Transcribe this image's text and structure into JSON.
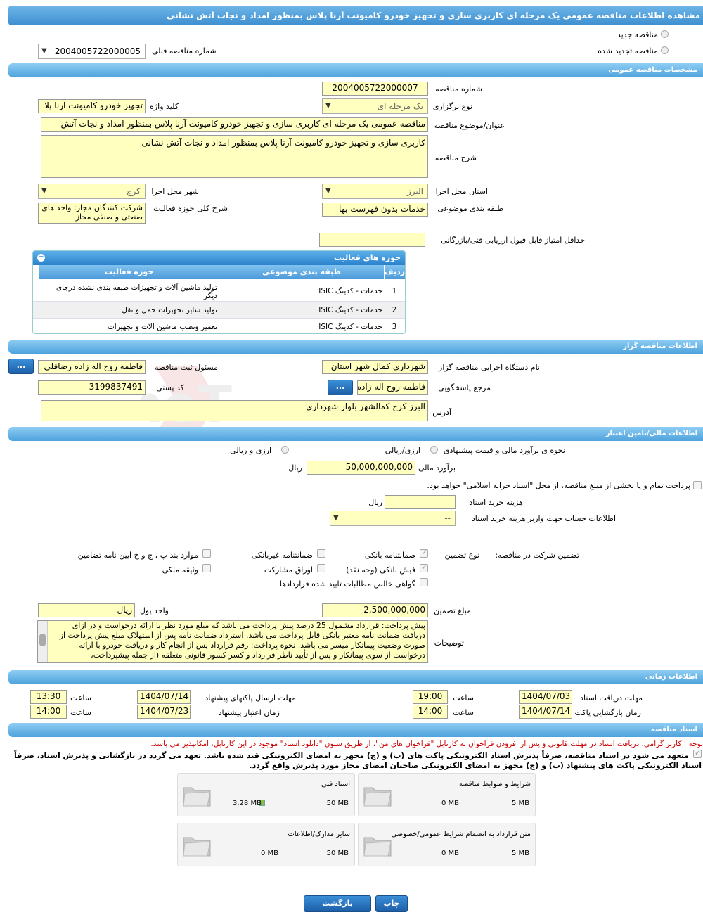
{
  "title": "مشاهده اطلاعات مناقصه عمومی یک مرحله ای کاربری سازی و تجهیز خودرو کامیونت آرنا پلاس بمنظور امداد و نجات آتش نشانی",
  "top": {
    "new_tender": "مناقصه جدید",
    "renewed_tender": "مناقصه تجدید شده",
    "prev_number_label": "شماره مناقصه قبلی",
    "prev_number": "2004005722000005"
  },
  "general": {
    "header": "مشخصات مناقصه عمومی",
    "number_label": "شماره مناقصه",
    "number": "2004005722000007",
    "type_label": "نوع برگزاری",
    "type": "یک مرحله ای",
    "keyword_label": "کلید واژه",
    "keyword": "تجهیز خودرو کامیونت آرنا پلا",
    "subject_label": "عنوان/موضوع مناقصه",
    "subject": "مناقصه عمومی یک مرحله ای کاربری سازی و تجهیز خودرو کامیونت آرنا پلاس بمنظور امداد و نجات آتش",
    "desc_label": "شرح مناقصه",
    "desc": "کاربری سازی و تجهیز خودرو کامیونت آرنا پلاس بمنظور امداد و نجات آتش نشانی",
    "province_label": "استان محل اجرا",
    "province": "البرز",
    "city_label": "شهر محل اجرا",
    "city": "کرج",
    "category_label": "طبقه بندی موضوعی",
    "category": "خدمات بدون فهرست بها",
    "activity_label": "شرح کلی حوزه فعالیت",
    "activity": "شرکت کنندگان مجاز: واحد های صنعتی و صنفی مجاز",
    "min_score_label": "حداقل امتیاز قابل قبول ارزیابی فنی/بازرگانی",
    "min_score": ""
  },
  "activities": {
    "header": "حوزه های فعالیت",
    "cols": [
      "ردیف",
      "طبقه بندی موضوعی",
      "حوزه فعالیت"
    ],
    "rows": [
      {
        "n": "1",
        "cat": "خدمات - کدینگ ISIC",
        "area": "تولید ماشین آلات و تجهیزات طبقه بندی نشده درجای دیگر"
      },
      {
        "n": "2",
        "cat": "خدمات - کدینگ ISIC",
        "area": "تولید سایر تجهیزات حمل و نقل"
      },
      {
        "n": "3",
        "cat": "خدمات - کدینگ ISIC",
        "area": "تعمیر ونصب ماشین آلات و تجهیزات"
      }
    ]
  },
  "organizer": {
    "header": "اطلاعات مناقصه گزار",
    "org_label": "نام دستگاه اجرایی مناقصه گزار",
    "org": "شهرداری کمال شهر استان",
    "registrar_label": "مسئول ثبت مناقصه",
    "registrar": "فاطمه روح اله زاده رضاقلی",
    "contact_label": "مرجع پاسخگویی",
    "contact": "فاطمه روح اله زاده",
    "postal_label": "کد پستی",
    "postal": "3199837491",
    "address_label": "آدرس",
    "address": "البرز کرج کمالشهر بلوار شهرداری",
    "more": "..."
  },
  "finance": {
    "header": "اطلاعات مالی/تامین اعتبار",
    "estimate_type_label": "نحوه ی برآورد مالی و قیمت پیشنهادی",
    "opt1": "ارزی/ریالی",
    "opt2": "ارزی و ریالی",
    "estimate_label": "برآورد مالی",
    "estimate": "50,000,000,000",
    "rial": "ریال",
    "treasury_text": "پرداخت تمام و یا بخشی از مبلغ مناقصه، از محل \"اسناد خزانه اسلامی\" خواهد بود.",
    "doc_cost_label": "هزینه خرید اسناد",
    "doc_cost": "",
    "account_label": "اطلاعات حساب جهت واریز هزینه خرید اسناد",
    "account": "--"
  },
  "guarantee": {
    "participation_label": "تضمین شرکت در مناقصه:",
    "type_label": "نوع تضمین",
    "bank_guarantee": "ضمانتنامه بانکی",
    "nonbank_guarantee": "ضمانتنامه غیربانکی",
    "articles": "موارد بند پ ، ج و خ آیین نامه تضامین",
    "bank_check": "فیش بانکی (وجه نقد)",
    "bonds": "اوراق مشارکت",
    "property": "وثیقه ملکی",
    "claims": "گواهی خالص مطالبات تایید شده قراردادها",
    "amount_label": "مبلغ تضمین",
    "amount": "2,500,000,000",
    "currency_label": "واحد پول",
    "currency": "ریال",
    "notes_label": "توضیحات",
    "notes": "پیش پرداخت: قرارداد مشمول 25 درصد پیش پرداخت می باشد که مبلغ مورد نظر با ارائه درخواست و در ازای دریافت ضمانت نامه معتبر بانکی قابل پرداخت می باشد. استرداد ضمانت نامه پس از استهلاک مبلغ پیش پرداخت از صورت وضعیت پیمانکار میسر می باشد. نحوه پرداخت: رقم قرارداد پس از انجام کار و دریافت خودرو با ارائه درخواست از سوی پیمانکار و پس از تأیید ناظر قرارداد و کسر کسور قانونی متعلقه (از جمله پیشپرداخت،"
  },
  "timing": {
    "header": "اطلاعات زمانی",
    "doc_deadline_label": "مهلت دریافت اسناد",
    "doc_deadline": "1404/07/03",
    "time_label": "ساعت",
    "doc_time": "19:00",
    "send_label": "مهلت ارسال پاکتهای پیشنهاد",
    "send_date": "1404/07/14",
    "send_time": "13:30",
    "open_label": "زمان بازگشایی پاکت ها",
    "open_date": "1404/07/14",
    "open_time": "14:00",
    "valid_label": "زمان اعتبار پیشنهاد",
    "valid_date": "1404/07/23",
    "valid_time": "14:00"
  },
  "docs": {
    "header": "اسناد مناقصه",
    "notice": "توجه : کاربر گرامی، دریافت اسناد در مهلت قانونی و پس از افزودن فراخوان به کارتابل \"فراخوان های من\"، از طریق ستون \"دانلود اسناد\" موجود در این کارتابل، امکانپذیر می باشد.",
    "commit": "متعهد می شود در اسناد مناقصه، صرفاً پذیرش اسناد الکترونیکی پاکت های (ب) و (ج) مجهز به امضای الکترونیکی قید شده باشد. تعهد می گردد در بازگشایی و پذیرش اسناد، صرفاً اسناد الکترونیکی پاکت های پیشنهاد (ب) و (ج) مجهز به امضای الکترونیکی صاحبان امضای مجاز مورد پذیرش واقع گردد.",
    "files": [
      {
        "name": "شرایط و ضوابط مناقصه",
        "used": "0 MB",
        "max": "5 MB"
      },
      {
        "name": "اسناد فنی",
        "used": "3.28 MB",
        "max": "50 MB"
      },
      {
        "name": "متن قرارداد به انضمام شرایط عمومی/خصوصی",
        "used": "0 MB",
        "max": "5 MB"
      },
      {
        "name": "سایر مدارک/اطلاعات",
        "used": "0 MB",
        "max": "50 MB"
      }
    ]
  },
  "actions": {
    "print": "چاپ",
    "back": "بازگشت"
  },
  "watermark": "AriaTender.neT"
}
